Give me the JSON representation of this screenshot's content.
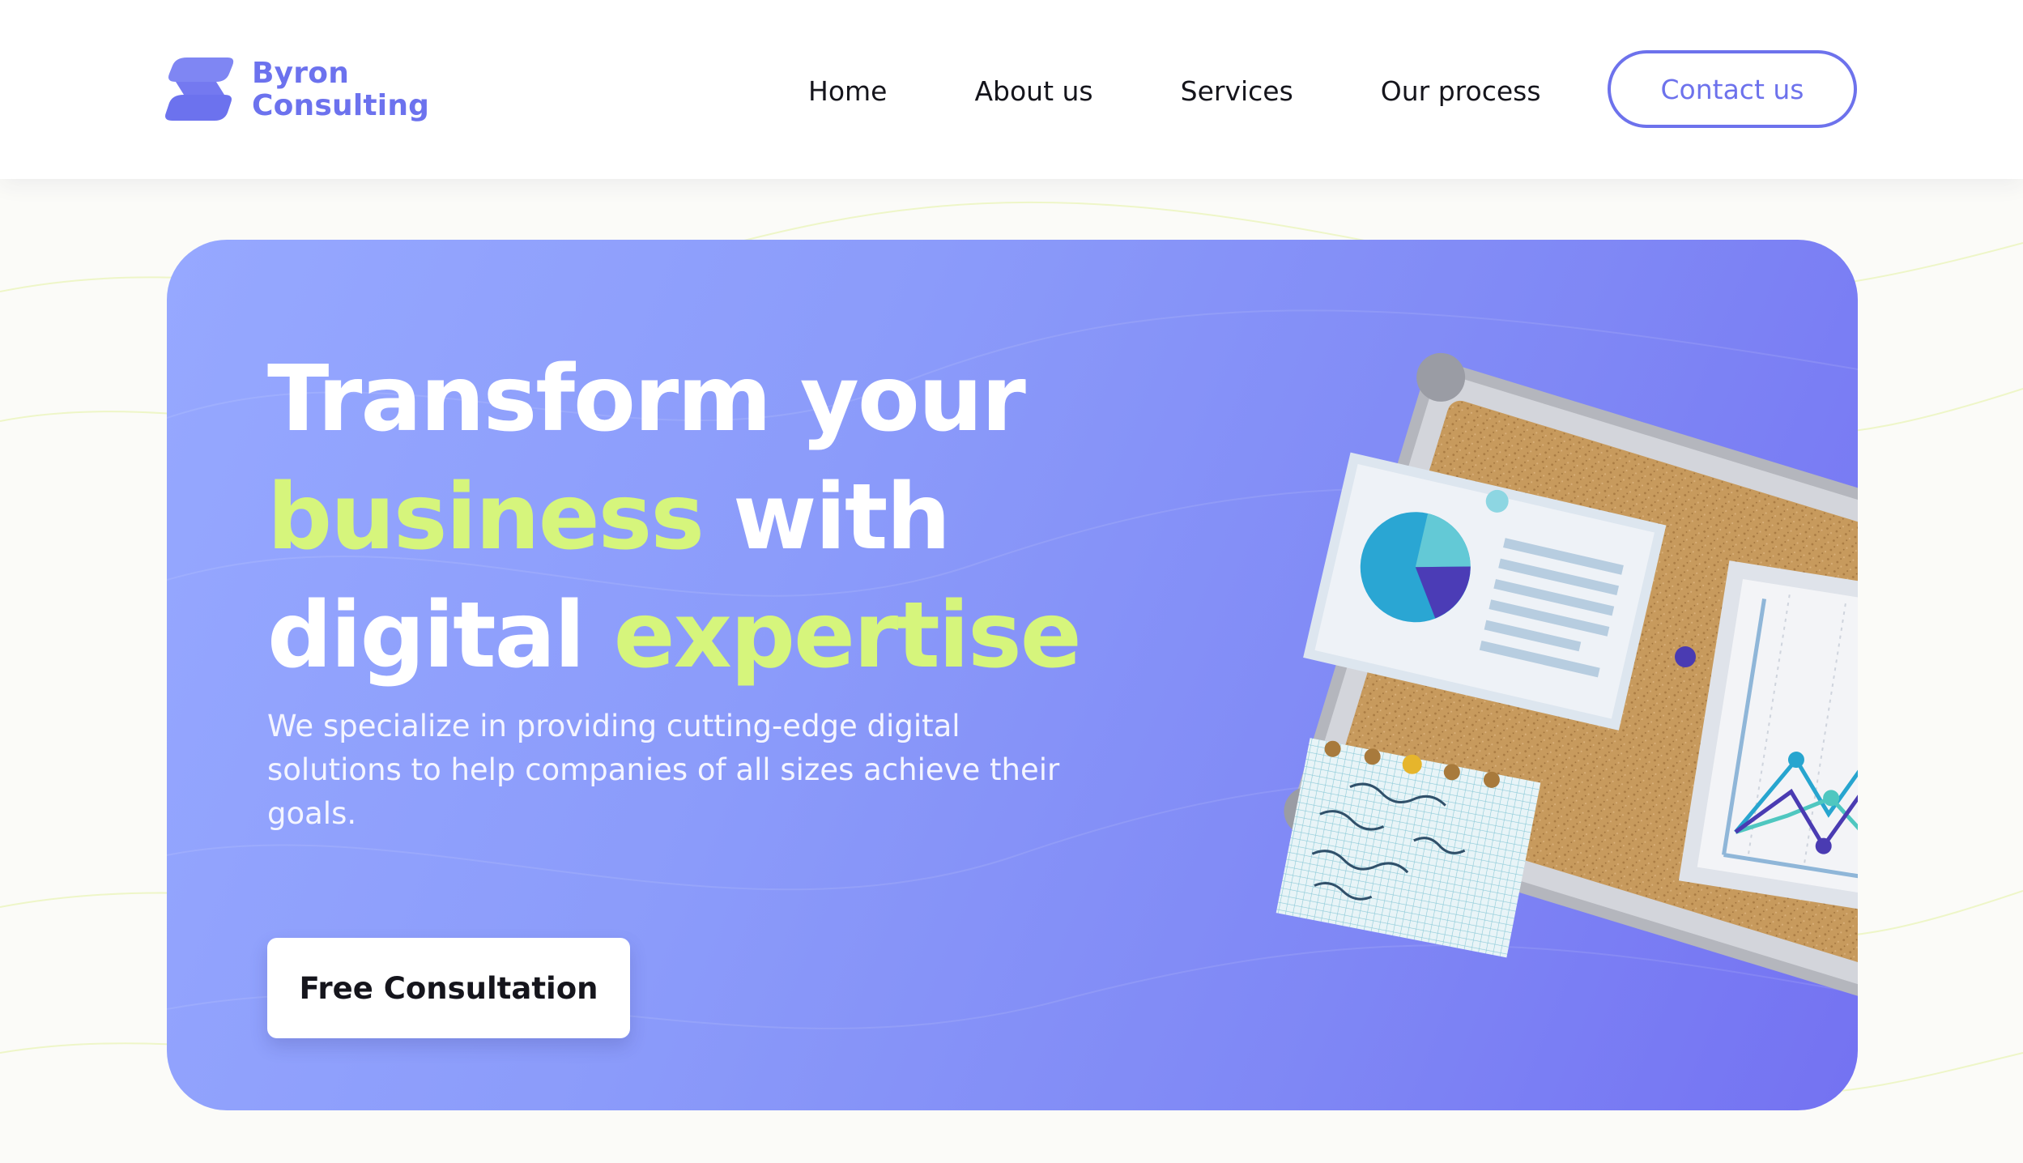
{
  "brand": {
    "name_line1": "Byron",
    "name_line2": "Consulting",
    "logo_icon": "s-stripes-logo-icon",
    "color": "#6c72ee"
  },
  "nav": {
    "items": [
      {
        "label": "Home"
      },
      {
        "label": "About us"
      },
      {
        "label": "Services"
      },
      {
        "label": "Our process"
      }
    ],
    "contact_label": "Contact us"
  },
  "hero": {
    "headline": {
      "line1": "Transform your",
      "line2_highlight": "business",
      "line2_rest": "with",
      "line3_start": "digital",
      "line3_highlight": "expertise"
    },
    "subtext": "We specialize in providing cutting-edge digital solutions to help companies of all sizes achieve their goals.",
    "cta_label": "Free Consultation",
    "illustration": "corkboard-charts-illustration"
  },
  "colors": {
    "accent": "#6c72ee",
    "highlight": "#d6f57c",
    "hero_gradient_start": "#96a8ff",
    "hero_gradient_end": "#7472f2"
  }
}
